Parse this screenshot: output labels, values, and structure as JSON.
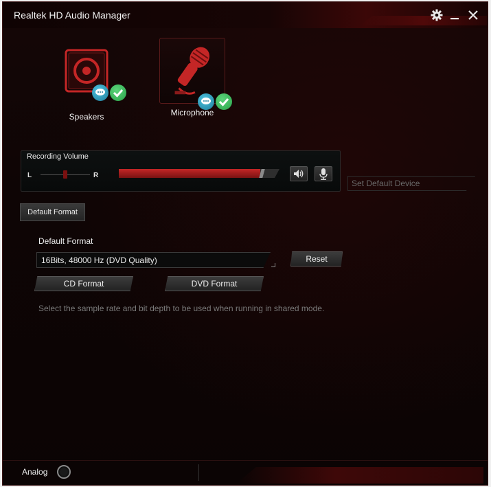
{
  "window": {
    "title": "Realtek HD Audio Manager",
    "settings_icon": "gear-icon",
    "minimize_icon": "minimize-icon",
    "close_icon": "close-icon"
  },
  "devices": [
    {
      "label": "Speakers",
      "icon": "speaker-icon",
      "selected": false
    },
    {
      "label": "Microphone",
      "icon": "microphone-icon",
      "selected": true
    }
  ],
  "recording": {
    "title": "Recording Volume",
    "left_label": "L",
    "right_label": "R",
    "balance": 0.5,
    "volume_fraction": 0.88,
    "mute_icon": "speaker-volume-icon",
    "mic_icon": "mic-boost-icon"
  },
  "set_default": {
    "label": "Set Default Device"
  },
  "tab": {
    "label": "Default Format"
  },
  "format": {
    "heading": "Default Format",
    "selected": "16Bits, 48000 Hz (DVD Quality)",
    "reset_label": "Reset",
    "cd_label": "CD Format",
    "dvd_label": "DVD Format",
    "hint": "Select the sample rate and bit depth to be used when running in shared mode."
  },
  "footer": {
    "analog_label": "Analog"
  },
  "colors": {
    "accent": "#c42626",
    "background": "#0e0505",
    "badge_blue": "#1e7d9a",
    "badge_green": "#2aa34a"
  }
}
